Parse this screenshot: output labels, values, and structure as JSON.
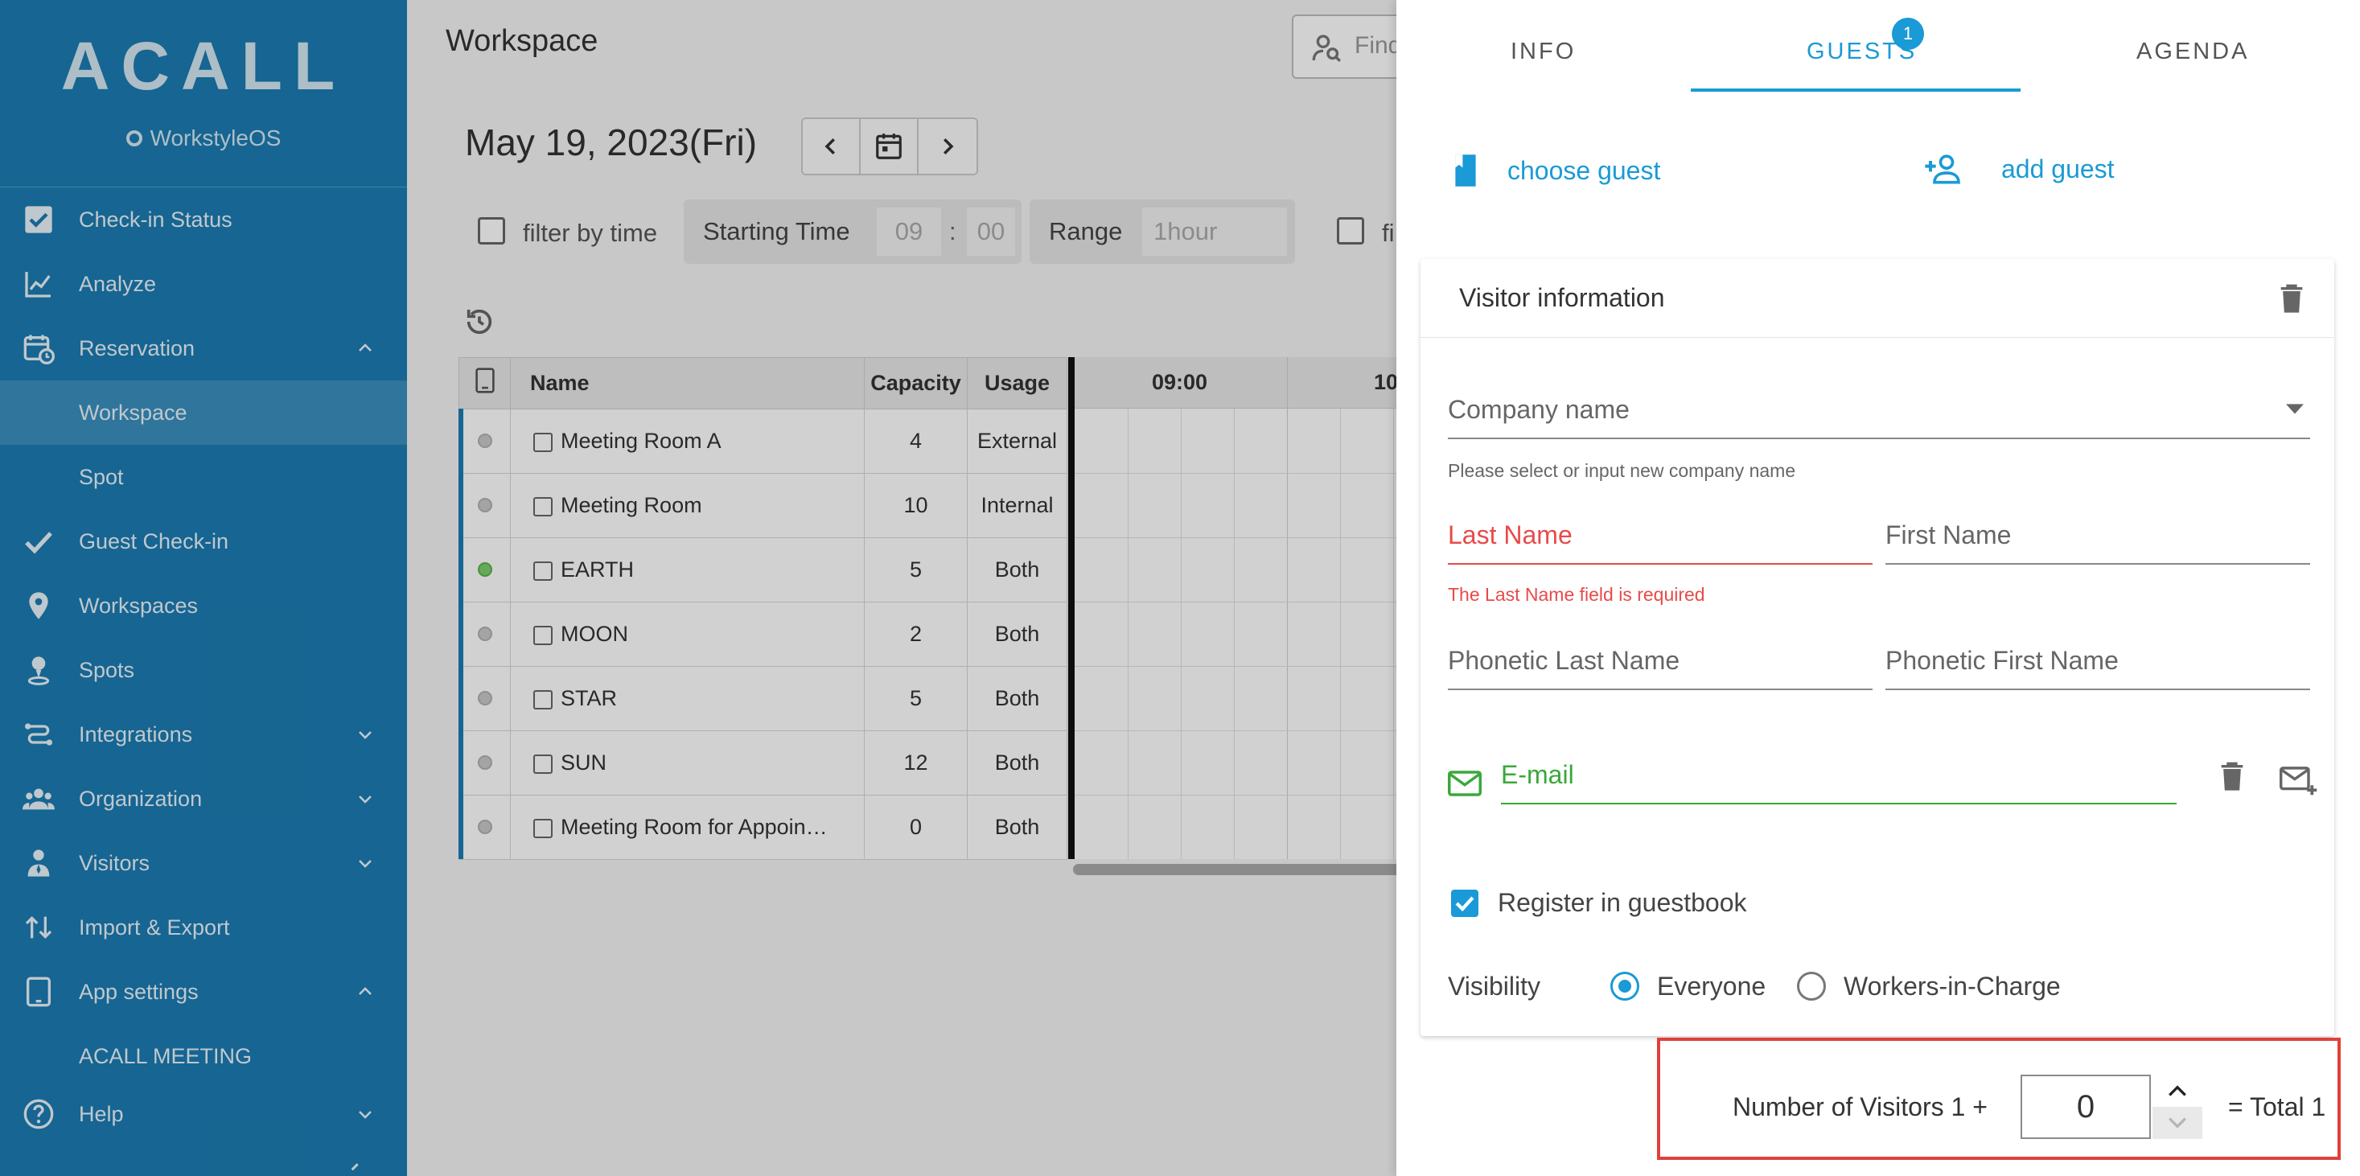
{
  "sidebar": {
    "logo": "ACALL",
    "sub_logo": "WorkstyleOS",
    "items": [
      {
        "label": "Check-in Status"
      },
      {
        "label": "Analyze"
      },
      {
        "label": "Reservation"
      },
      {
        "label": "Workspace"
      },
      {
        "label": "Spot"
      },
      {
        "label": "Guest Check-in"
      },
      {
        "label": "Workspaces"
      },
      {
        "label": "Spots"
      },
      {
        "label": "Integrations"
      },
      {
        "label": "Organization"
      },
      {
        "label": "Visitors"
      },
      {
        "label": "Import & Export"
      },
      {
        "label": "App settings"
      },
      {
        "label": "ACALL MEETING"
      },
      {
        "label": "Help"
      }
    ]
  },
  "main": {
    "title": "Workspace",
    "search_placeholder": "Find",
    "date": "May 19, 2023(Fri)",
    "filters": {
      "filter_by_time": "filter by time",
      "starting_time_label": "Starting Time",
      "hour": "09",
      "sep": ":",
      "minute": "00",
      "range_label": "Range",
      "range_value": "1hour",
      "second_filter": "fi"
    },
    "table": {
      "headers": [
        "Name",
        "Capacity",
        "Usage"
      ],
      "rows": [
        {
          "name": "Meeting Room A",
          "capacity": "4",
          "usage": "External",
          "status": "grey"
        },
        {
          "name": "Meeting Room",
          "capacity": "10",
          "usage": "Internal",
          "status": "grey"
        },
        {
          "name": "EARTH",
          "capacity": "5",
          "usage": "Both",
          "status": "green"
        },
        {
          "name": "MOON",
          "capacity": "2",
          "usage": "Both",
          "status": "grey"
        },
        {
          "name": "STAR",
          "capacity": "5",
          "usage": "Both",
          "status": "grey"
        },
        {
          "name": "SUN",
          "capacity": "12",
          "usage": "Both",
          "status": "grey"
        },
        {
          "name": "Meeting Room for Appoin…",
          "capacity": "0",
          "usage": "Both",
          "status": "grey"
        }
      ],
      "timeline_headers": [
        "09:00",
        "10"
      ]
    }
  },
  "drawer": {
    "tabs": [
      "INFO",
      "GUESTS",
      "AGENDA"
    ],
    "active_tab": "GUESTS",
    "guest_badge": "1",
    "choose_guest": "choose guest",
    "add_guest": "add guest",
    "card_title": "Visitor information",
    "company_placeholder": "Company name",
    "company_helper": "Please select or input new company name",
    "last_name_placeholder": "Last Name",
    "last_name_error": "The Last Name field is required",
    "first_name_placeholder": "First Name",
    "phonetic_last_placeholder": "Phonetic Last Name",
    "phonetic_first_placeholder": "Phonetic First Name",
    "email_placeholder": "E-mail",
    "register_guestbook": "Register in guestbook",
    "visibility_label": "Visibility",
    "visibility_options": [
      "Everyone",
      "Workers-in-Charge"
    ],
    "visibility_selected": "Everyone",
    "visitors_label": "Number of Visitors 1 +",
    "visitors_value": "0",
    "visitors_total": "= Total 1"
  },
  "colors": {
    "sidebar": "#1c7cb2",
    "accent": "#1a9ad6",
    "error": "#e84a4a",
    "success": "#3aa83a",
    "highlight_box": "#e0403a"
  }
}
